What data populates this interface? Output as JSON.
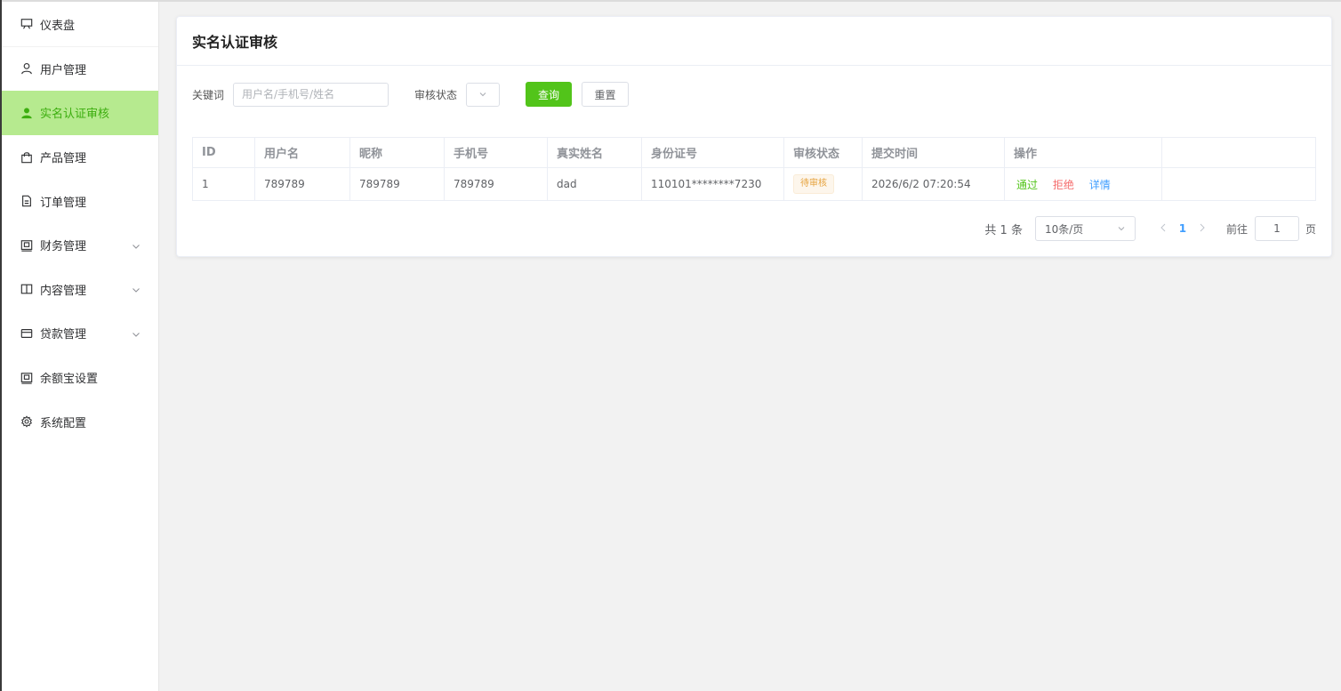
{
  "sidebar": {
    "items": [
      {
        "label": "仪表盘",
        "icon": "monitor-icon"
      },
      {
        "label": "用户管理",
        "icon": "user-icon"
      },
      {
        "label": "实名认证审核",
        "icon": "user-solid-icon",
        "active": true
      },
      {
        "label": "产品管理",
        "icon": "bag-icon"
      },
      {
        "label": "订单管理",
        "icon": "document-icon"
      },
      {
        "label": "财务管理",
        "icon": "wallet-icon",
        "expandable": true
      },
      {
        "label": "内容管理",
        "icon": "book-icon",
        "expandable": true
      },
      {
        "label": "贷款管理",
        "icon": "card-icon",
        "expandable": true
      },
      {
        "label": "余额宝设置",
        "icon": "wallet-icon"
      },
      {
        "label": "系统配置",
        "icon": "gear-icon"
      }
    ]
  },
  "page": {
    "title": "实名认证审核"
  },
  "filters": {
    "keyword_label": "关键词",
    "keyword_placeholder": "用户名/手机号/姓名",
    "keyword_value": "",
    "status_label": "审核状态",
    "search_button": "查询",
    "reset_button": "重置"
  },
  "table": {
    "columns": [
      "ID",
      "用户名",
      "昵称",
      "手机号",
      "真实姓名",
      "身份证号",
      "审核状态",
      "提交时间",
      "操作"
    ],
    "rows": [
      {
        "id": "1",
        "username": "789789",
        "nickname": "789789",
        "phone": "789789",
        "real_name": "dad",
        "id_card": "110101********7230",
        "status": "待审核",
        "submit_time": "2026/6/2 07:20:54",
        "actions": {
          "pass": "通过",
          "reject": "拒绝",
          "detail": "详情"
        }
      }
    ]
  },
  "pagination": {
    "total": "共 1 条",
    "page_size": "10条/页",
    "current_page": "1",
    "goto_label": "前往",
    "goto_value": "1",
    "page_suffix": "页"
  },
  "colors": {
    "accent": "#52c41a",
    "active_bg": "#b6ea8f",
    "active_text": "#3cae0f",
    "reject": "#f56c6c",
    "link": "#409eff",
    "warning": "#e6a23c"
  }
}
